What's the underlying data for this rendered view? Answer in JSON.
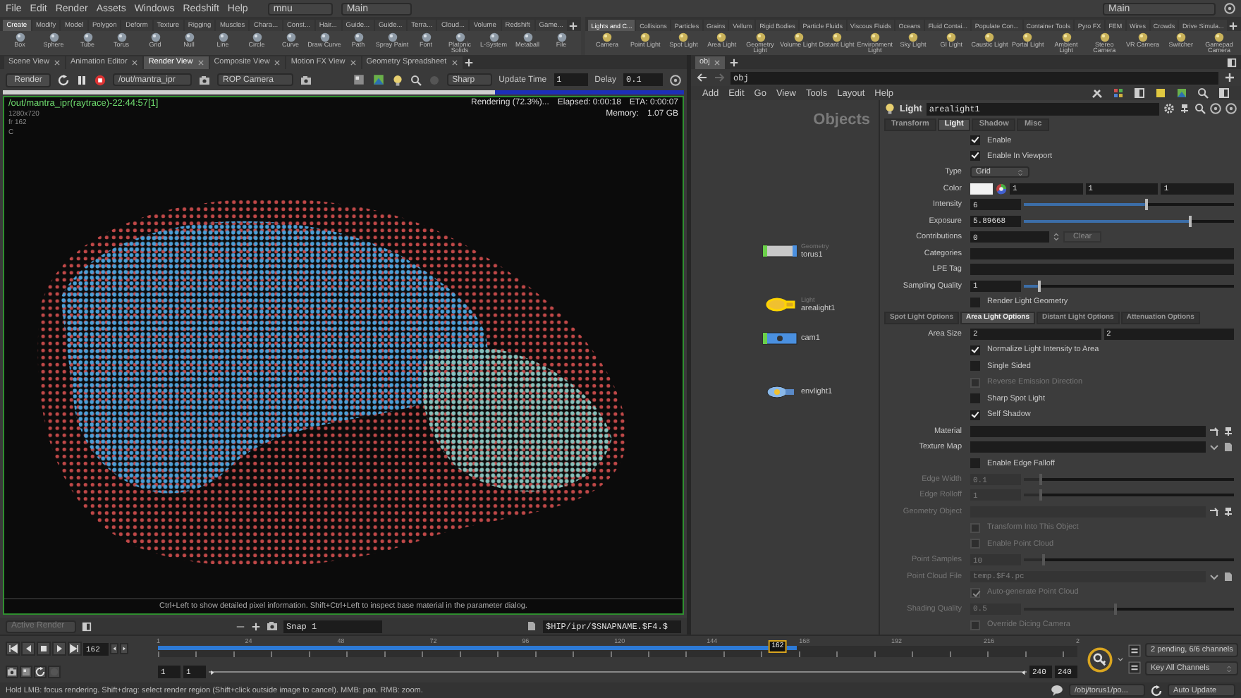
{
  "menu_bar": {
    "menus": [
      "File",
      "Edit",
      "Render",
      "Assets",
      "Windows",
      "Redshift",
      "Help"
    ],
    "desktop": "mnu",
    "context": "Main",
    "right_context": "Main"
  },
  "shelves": [
    {
      "tabs": [
        {
          "label": "Create",
          "selected": true
        },
        {
          "label": "Modify",
          "selected": false
        },
        {
          "label": "Model",
          "selected": false
        },
        {
          "label": "Polygon",
          "selected": false
        },
        {
          "label": "Deform",
          "selected": false
        },
        {
          "label": "Texture",
          "selected": false
        },
        {
          "label": "Rigging",
          "selected": false
        },
        {
          "label": "Muscles",
          "selected": false
        },
        {
          "label": "Chara...",
          "selected": false
        },
        {
          "label": "Const...",
          "selected": false
        },
        {
          "label": "Hair...",
          "selected": false
        },
        {
          "label": "Guide...",
          "selected": false
        },
        {
          "label": "Guide...",
          "selected": false
        },
        {
          "label": "Terra...",
          "selected": false
        },
        {
          "label": "Cloud...",
          "selected": false
        },
        {
          "label": "Volume",
          "selected": false
        },
        {
          "label": "Redshift",
          "selected": false
        },
        {
          "label": "Game...",
          "selected": false
        }
      ],
      "tools": [
        "Box",
        "Sphere",
        "Tube",
        "Torus",
        "Grid",
        "Null",
        "Line",
        "Circle",
        "Curve",
        "Draw Curve",
        "Path",
        "Spray Paint",
        "Font",
        "Platonic Solids",
        "L-System",
        "Metaball",
        "File"
      ]
    },
    {
      "tabs": [
        {
          "label": "Lights and C...",
          "selected": true
        },
        {
          "label": "Collisions",
          "selected": false
        },
        {
          "label": "Particles",
          "selected": false
        },
        {
          "label": "Grains",
          "selected": false
        },
        {
          "label": "Vellum",
          "selected": false
        },
        {
          "label": "Rigid Bodies",
          "selected": false
        },
        {
          "label": "Particle Fluids",
          "selected": false
        },
        {
          "label": "Viscous Fluids",
          "selected": false
        },
        {
          "label": "Oceans",
          "selected": false
        },
        {
          "label": "Fluid Contai...",
          "selected": false
        },
        {
          "label": "Populate Con...",
          "selected": false
        },
        {
          "label": "Container Tools",
          "selected": false
        },
        {
          "label": "Pyro FX",
          "selected": false
        },
        {
          "label": "FEM",
          "selected": false
        },
        {
          "label": "Wires",
          "selected": false
        },
        {
          "label": "Crowds",
          "selected": false
        },
        {
          "label": "Drive Simula...",
          "selected": false
        }
      ],
      "tools": [
        "Camera",
        "Point Light",
        "Spot Light",
        "Area Light",
        "Geometry Light",
        "Volume Light",
        "Distant Light",
        "Environment Light",
        "Sky Light",
        "GI Light",
        "Caustic Light",
        "Portal Light",
        "Ambient Light",
        "Stereo Camera",
        "VR Camera",
        "Switcher",
        "Gamepad Camera"
      ]
    }
  ],
  "render_view": {
    "tabs": [
      {
        "label": "Scene View",
        "selected": false
      },
      {
        "label": "Animation Editor",
        "selected": false
      },
      {
        "label": "Render View",
        "selected": true
      },
      {
        "label": "Composite View",
        "selected": false
      },
      {
        "label": "Motion FX View",
        "selected": false
      },
      {
        "label": "Geometry Spreadsheet",
        "selected": false
      }
    ],
    "toolbar": {
      "render_button": "Render",
      "rop": "/out/mantra_ipr",
      "camera": "ROP Camera",
      "preview": "Sharp",
      "update_time_label": "Update Time",
      "update_time": "1",
      "delay_label": "Delay",
      "delay": "0.1"
    },
    "progress": {
      "level": 0.723
    },
    "image": {
      "title": "/out/mantra_ipr(raytrace)-22:44:57[1]",
      "resolution": "1280x720",
      "frame": "fr 162",
      "channel": "C",
      "status": "Rendering (72.3%)...",
      "elapsed": "Elapsed: 0:00:18",
      "eta": "ETA: 0:00:07",
      "memory_label": "Memory:",
      "memory": "1.07 GB",
      "hint": "Ctrl+Left to show detailed pixel information. Shift+Ctrl+Left to inspect base material in the parameter dialog."
    },
    "snapshot_bar": {
      "mode": "Active Render",
      "snapshot": "Snap 1",
      "file": "$HIP/ipr/$SNAPNAME.$F4.$"
    }
  },
  "network": {
    "tab": "obj",
    "path": "obj",
    "menus": [
      "Add",
      "Edit",
      "Go",
      "View",
      "Tools",
      "Layout",
      "Help"
    ],
    "context_label": "Objects",
    "nodes": [
      {
        "name": "torus1",
        "type": "Geometry",
        "kind": "geometry",
        "selected": false
      },
      {
        "name": "arealight1",
        "type": "Light",
        "kind": "light",
        "selected": true
      },
      {
        "name": "cam1",
        "kind": "camera",
        "selected": false
      },
      {
        "name": "envlight1",
        "kind": "envlight",
        "selected": false
      }
    ]
  },
  "parameters": {
    "type": "Light",
    "name": "arealight1",
    "tabs": [
      {
        "label": "Transform",
        "selected": false
      },
      {
        "label": "Light",
        "selected": true
      },
      {
        "label": "Shadow",
        "selected": false
      },
      {
        "label": "Misc",
        "selected": false
      }
    ],
    "rows": [
      {
        "kind": "toggle",
        "label": "Enable",
        "checked": true,
        "disabled": false
      },
      {
        "kind": "toggle",
        "label": "Enable In Viewport",
        "checked": true,
        "disabled": false
      },
      {
        "kind": "menu",
        "label": "Type",
        "value": "Grid",
        "disabled": false
      },
      {
        "kind": "color",
        "label": "Color",
        "values": [
          "1",
          "1",
          "1"
        ],
        "disabled": false
      },
      {
        "kind": "slider",
        "label": "Intensity",
        "value": "6",
        "level": 0.59,
        "disabled": false
      },
      {
        "kind": "slider",
        "label": "Exposure",
        "value": "5.89668",
        "level": 0.8,
        "disabled": false
      },
      {
        "kind": "counter",
        "label": "Contributions",
        "value": "0",
        "button": "Clear",
        "disabled": false
      },
      {
        "kind": "text",
        "label": "Categories",
        "disabled": false
      },
      {
        "kind": "text",
        "label": "LPE Tag",
        "disabled": false
      },
      {
        "kind": "slider",
        "label": "Sampling Quality",
        "value": "1",
        "level": 0.08,
        "disabled": false
      },
      {
        "kind": "toggle",
        "label": "Render Light Geometry",
        "checked": false,
        "disabled": false
      },
      {
        "kind": "tabs",
        "tabs": [
          {
            "label": "Spot Light Options",
            "selected": false
          },
          {
            "label": "Area Light Options",
            "selected": true
          },
          {
            "label": "Distant Light Options",
            "selected": false
          },
          {
            "label": "Attenuation Options",
            "selected": false
          }
        ]
      },
      {
        "kind": "vector",
        "label": "Area Size",
        "values": [
          "2",
          "2"
        ],
        "disabled": false
      },
      {
        "kind": "toggle",
        "label": "Normalize Light Intensity to Area",
        "checked": true,
        "disabled": false
      },
      {
        "kind": "toggle",
        "label": "Single Sided",
        "checked": false,
        "disabled": false
      },
      {
        "kind": "toggle",
        "label": "Reverse Emission Direction",
        "checked": false,
        "disabled": true
      },
      {
        "kind": "toggle",
        "label": "Sharp Spot Light",
        "checked": false,
        "disabled": false
      },
      {
        "kind": "toggle",
        "label": "Self Shadow",
        "checked": true,
        "disabled": false
      },
      {
        "kind": "path",
        "label": "Material",
        "disabled": false
      },
      {
        "kind": "file",
        "label": "Texture Map",
        "disabled": false
      },
      {
        "kind": "toggle",
        "label": "Enable Edge Falloff",
        "checked": false,
        "disabled": false
      },
      {
        "kind": "slider",
        "label": "Edge Width",
        "value": "0.1",
        "level": 0.09,
        "disabled": true
      },
      {
        "kind": "slider",
        "label": "Edge Rolloff",
        "value": "1",
        "level": 0.09,
        "disabled": true
      },
      {
        "kind": "path",
        "label": "Geometry Object",
        "disabled": true
      },
      {
        "kind": "toggle",
        "label": "Transform Into This Object",
        "checked": false,
        "disabled": true
      },
      {
        "kind": "toggle",
        "label": "Enable Point Cloud",
        "checked": false,
        "disabled": true
      },
      {
        "kind": "slider",
        "label": "Point Samples",
        "value": "10",
        "level": 0.1,
        "disabled": true
      },
      {
        "kind": "file",
        "label": "Point Cloud File",
        "value": "temp.$F4.pc",
        "disabled": true
      },
      {
        "kind": "toggle",
        "label": "Auto-generate Point Cloud",
        "checked": true,
        "disabled": true
      },
      {
        "kind": "slider",
        "label": "Shading Quality",
        "value": "0.5",
        "level": 0.44,
        "disabled": true
      },
      {
        "kind": "toggle",
        "label": "Override Dicing Camera",
        "checked": false,
        "disabled": true
      }
    ]
  },
  "timeline": {
    "frame_field": "162",
    "ticks": [
      "1",
      "24",
      "48",
      "72",
      "96",
      "120",
      "144",
      "168",
      "192",
      "216",
      "2"
    ],
    "playhead": {
      "label": "162",
      "level": 0.674
    },
    "cache": {
      "level": 0.695
    },
    "range": [
      "1",
      "1",
      "240",
      "240"
    ],
    "keys_status": "2 pending, 6/6 channels",
    "key_mode": "Key All Channels"
  },
  "status_bar": {
    "message": "Hold LMB: focus rendering. Shift+drag: select render region (Shift+click outside image to cancel). MMB: pan. RMB: zoom.",
    "path": "/obj/torus1/po...",
    "update_mode": "Auto Update"
  }
}
